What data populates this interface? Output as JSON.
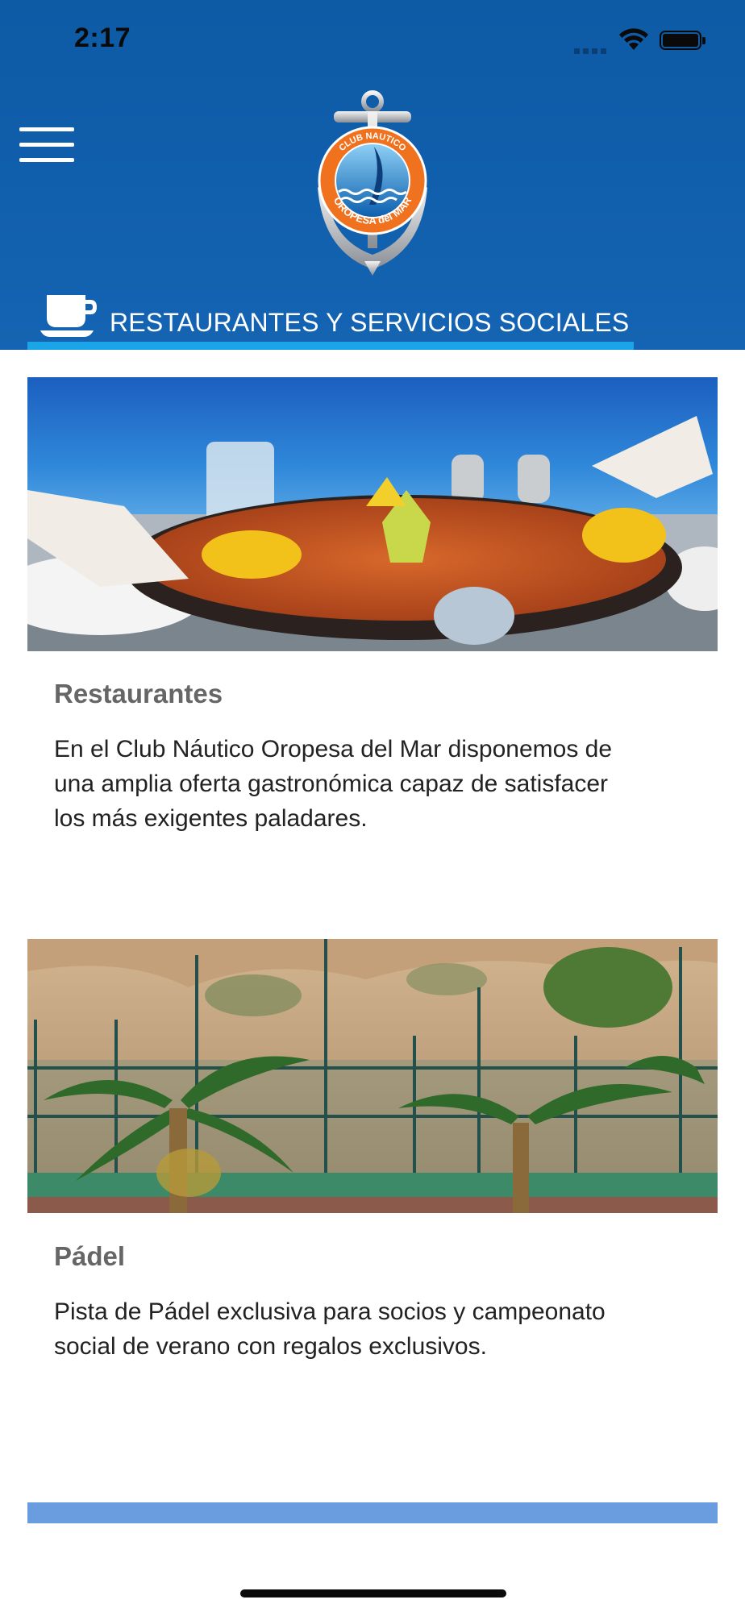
{
  "status_bar": {
    "time": "2:17"
  },
  "header": {
    "logo_text_top": "CLUB NAUTICO",
    "logo_text_bottom": "OROPESA del MAR",
    "section_title": "RESTAURANTES Y SERVICIOS SOCIALES",
    "section_icon": "coffee-cup-icon",
    "underline_color": "#1ba4e8",
    "background_color": "#1464b3"
  },
  "cards": [
    {
      "title": "Restaurantes",
      "description": "En el Club Náutico Oropesa del Mar disponemos de una amplia oferta gastronómica capaz de satisfacer los más exigentes paladares."
    },
    {
      "title": "Pádel",
      "description": "Pista de Pádel exclusiva para socios y campeonato social de verano con regalos exclusivos."
    }
  ]
}
